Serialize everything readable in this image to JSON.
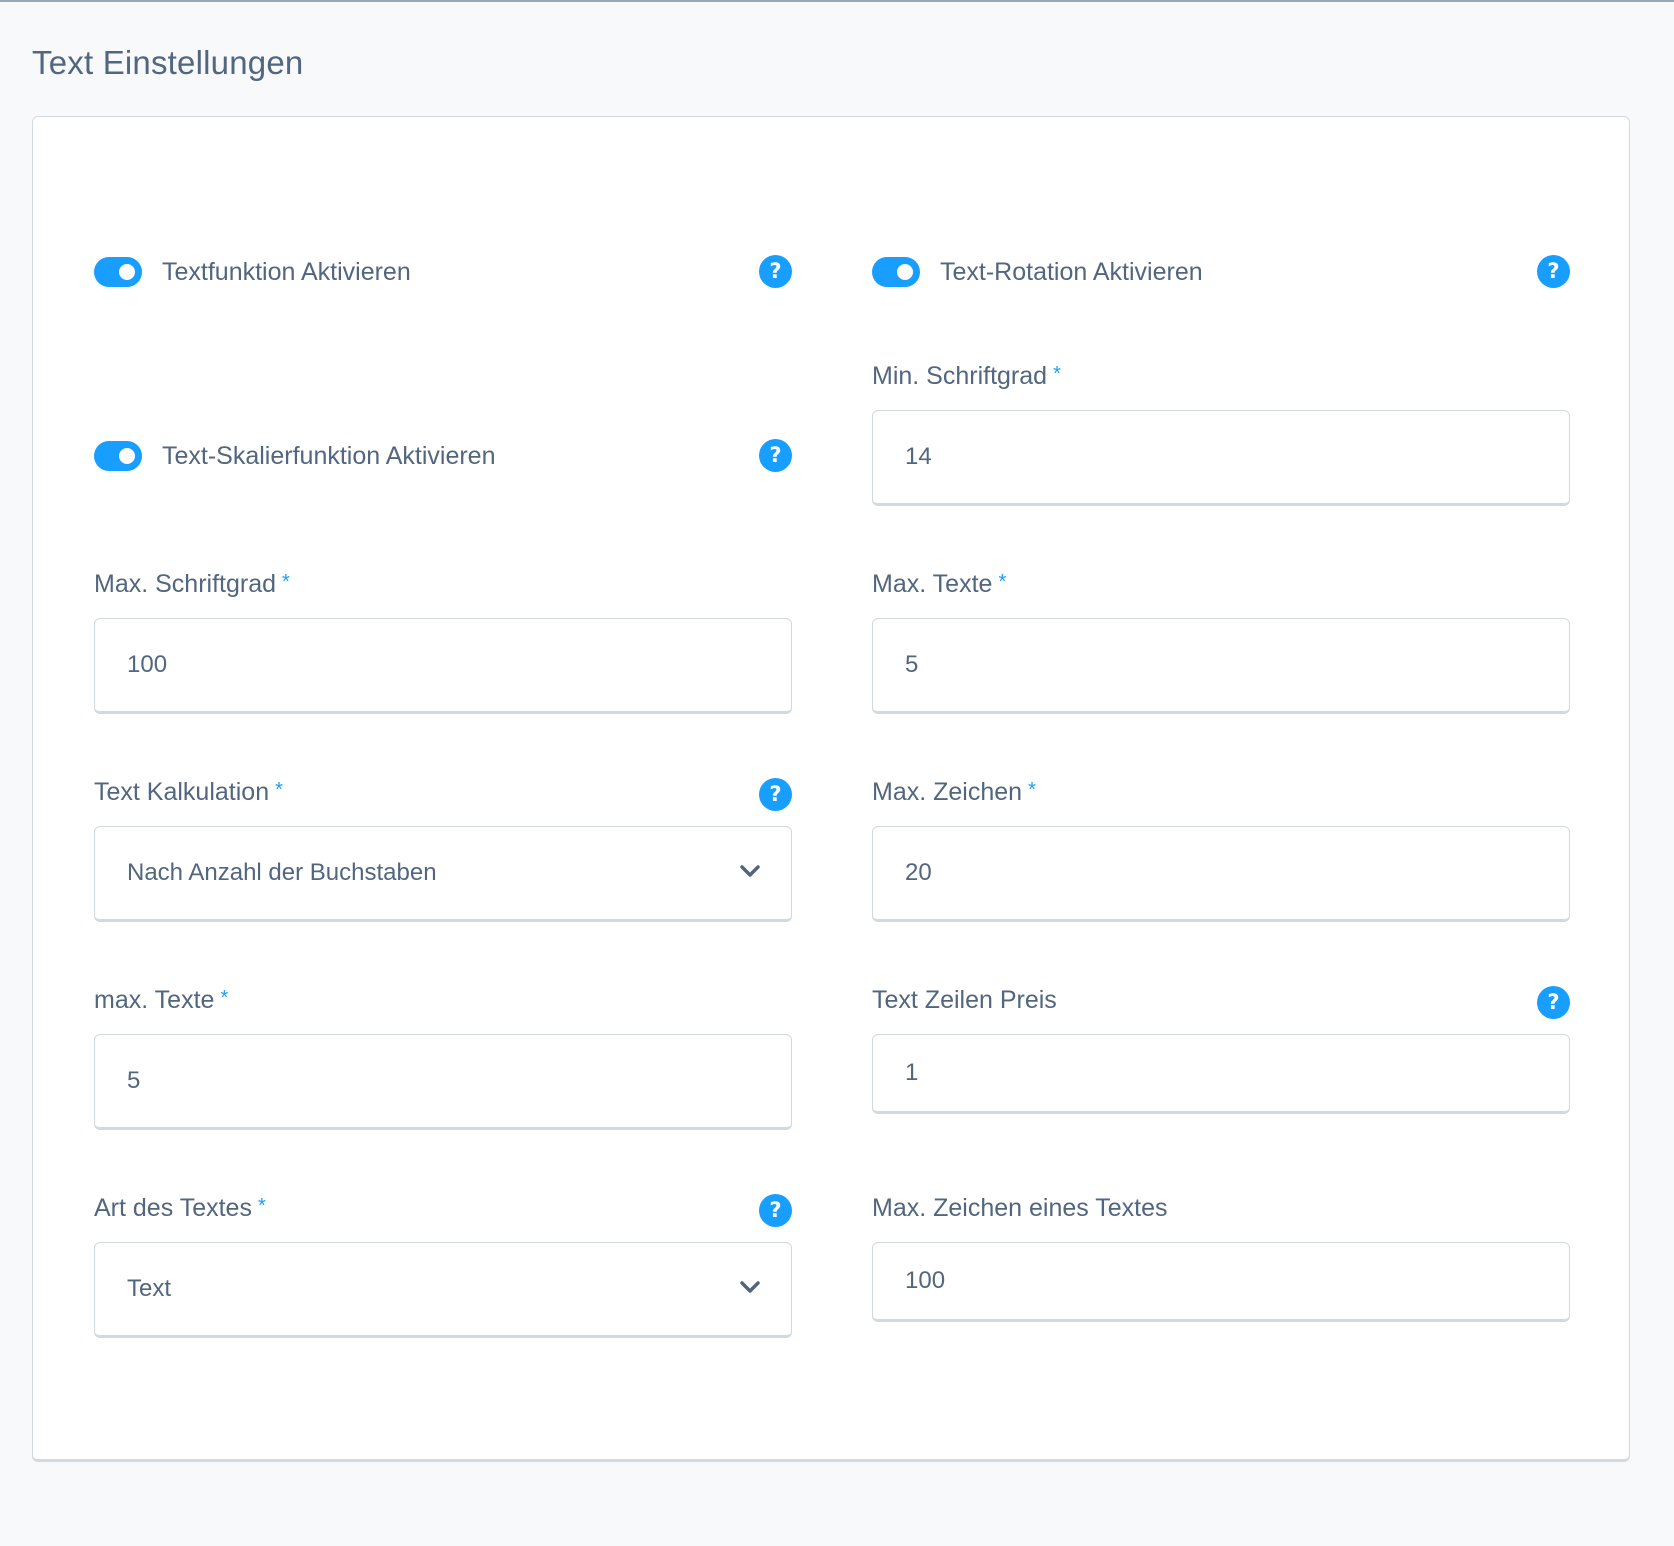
{
  "page": {
    "title": "Text Einstellungen"
  },
  "toggles": [
    {
      "label": "Textfunktion Aktivieren",
      "enabled": true,
      "help": "?"
    },
    {
      "label": "Text-Rotation Aktivieren",
      "enabled": true,
      "help": "?"
    },
    {
      "label": "Text-Skalierfunktion Aktivieren",
      "enabled": true,
      "help": "?"
    }
  ],
  "fields": {
    "min_schriftgrad": {
      "label": "Min. Schriftgrad",
      "required": "*",
      "value": "14"
    },
    "max_schriftgrad": {
      "label": "Max. Schriftgrad",
      "required": "*",
      "value": "100"
    },
    "max_texte": {
      "label": "Max. Texte",
      "required": "*",
      "value": "5"
    },
    "text_kalkulation": {
      "label": "Text Kalkulation",
      "required": "*",
      "value": "Nach Anzahl der Buchstaben",
      "help": "?"
    },
    "max_zeichen": {
      "label": "Max. Zeichen",
      "required": "*",
      "value": "20"
    },
    "max_texte_lower": {
      "label": "max. Texte",
      "required": "*",
      "value": "5"
    },
    "text_zeilen_preis": {
      "label": "Text Zeilen Preis",
      "value": "1",
      "help": "?"
    },
    "art_des_textes": {
      "label": "Art des Textes",
      "required": "*",
      "value": "Text",
      "help": "?"
    },
    "max_zeichen_eines_textes": {
      "label": "Max. Zeichen eines Textes",
      "value": "100"
    }
  },
  "colors": {
    "accent": "#189eff",
    "text": "#52667f",
    "border": "#d1d9e1",
    "background": "#f8f9fb"
  }
}
